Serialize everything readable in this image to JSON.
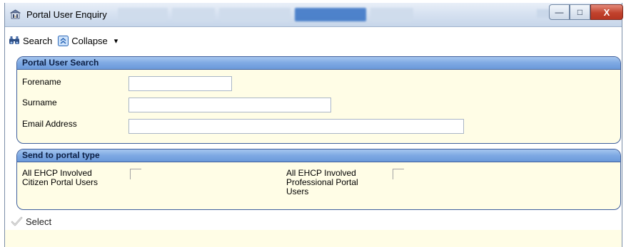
{
  "window": {
    "title": "Portal User Enquiry",
    "controls": {
      "minimize": "—",
      "maximize": "□",
      "close": "X"
    }
  },
  "toolbar": {
    "search_label": "Search",
    "collapse_label": "Collapse",
    "dropdown_arrow": "▾"
  },
  "search_panel": {
    "header": "Portal User Search",
    "fields": [
      {
        "label": "Forename",
        "value": ""
      },
      {
        "label": "Surname",
        "value": ""
      },
      {
        "label": "Email Address",
        "value": ""
      }
    ]
  },
  "portal_type_panel": {
    "header": "Send to portal type",
    "options": [
      {
        "line1": "All EHCP Involved",
        "line2": "Citizen Portal Users",
        "line3": "",
        "checked": false
      },
      {
        "line1": "All EHCP Involved",
        "line2": "Professional Portal",
        "line3": "Users",
        "checked": false
      }
    ]
  },
  "footer": {
    "select_label": "Select"
  },
  "colors": {
    "panel_header": "#7ea9e3",
    "panel_bg": "#fffde6",
    "panel_border": "#3f5f9c",
    "close_button": "#c1432d"
  }
}
